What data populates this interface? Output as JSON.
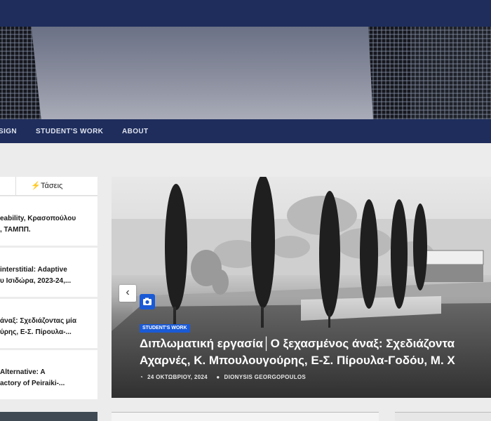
{
  "nav": {
    "items": [
      {
        "label": "SIGN"
      },
      {
        "label": "STUDENT'S WORK"
      },
      {
        "label": "ABOUT"
      }
    ]
  },
  "sidebar": {
    "tab_label": "Τάσεις",
    "posts": [
      {
        "line1": "eability, Κρασοπούλου",
        "line2": ", ΤΑΜΠΠ."
      },
      {
        "line1": "interstitial: Adaptive",
        "line2": "υ Ισιδώρα, 2023-24,..."
      },
      {
        "line1": "άναξ: Σχεδιάζοντας μία",
        "line2": "ύρης, Ε-Σ. Πίρουλα-..."
      },
      {
        "line1": "Alternative: A",
        "line2": "actory of Peiraiki-..."
      }
    ]
  },
  "feature": {
    "category": "STUDENT'S WORK",
    "title_line1": "Διπλωματική εργασία│Ο ξεχασμένος άναξ: Σχεδιάζοντα",
    "title_line2": "Αχαρνές, Κ. Μπουλουγούρης, Ε-Σ. Πίρουλα-Γοδόυ, Μ. Χ",
    "date": "24 ΟΚΤΩΒΡΙΟΥ, 2024",
    "author": "DIONYSIS GEORGOPOULOS"
  }
}
